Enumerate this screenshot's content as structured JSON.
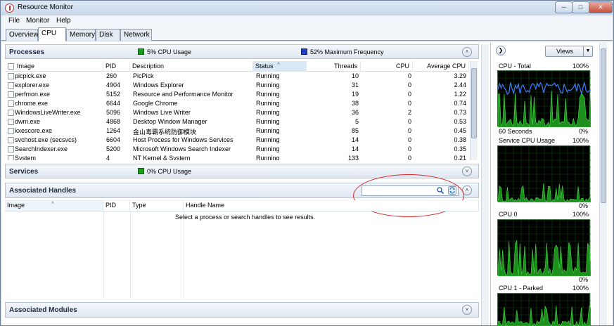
{
  "window": {
    "title": "Resource Monitor",
    "min_glyph": "─",
    "max_glyph": "□",
    "close_glyph": "✕"
  },
  "menu": [
    "File",
    "Monitor",
    "Help"
  ],
  "tabs": [
    "Overview",
    "CPU",
    "Memory",
    "Disk",
    "Network"
  ],
  "active_tab": "CPU",
  "processes": {
    "title": "Processes",
    "legend_cpu": "5% CPU Usage",
    "legend_freq": "52% Maximum Frequency",
    "legend_cpu_color": "#1b9c1b",
    "legend_freq_color": "#1f3fbf",
    "columns": [
      "Image",
      "PID",
      "Description",
      "Status",
      "Threads",
      "CPU",
      "Average CPU"
    ],
    "rows": [
      [
        "picpick.exe",
        "260",
        "PicPick",
        "Running",
        "10",
        "0",
        "3.29"
      ],
      [
        "explorer.exe",
        "4904",
        "Windows Explorer",
        "Running",
        "31",
        "0",
        "2.44"
      ],
      [
        "perfmon.exe",
        "5152",
        "Resource and Performance Monitor",
        "Running",
        "19",
        "0",
        "1.22"
      ],
      [
        "chrome.exe",
        "6644",
        "Google Chrome",
        "Running",
        "38",
        "0",
        "0.74"
      ],
      [
        "WindowsLiveWriter.exe",
        "5096",
        "Windows Live Writer",
        "Running",
        "36",
        "2",
        "0.73"
      ],
      [
        "dwm.exe",
        "4868",
        "Desktop Window Manager",
        "Running",
        "5",
        "0",
        "0.53"
      ],
      [
        "kxescore.exe",
        "1264",
        "金山毒霸系统防御模块",
        "Running",
        "85",
        "0",
        "0.45"
      ],
      [
        "svchost.exe (secsvcs)",
        "6604",
        "Host Process for Windows Services",
        "Running",
        "14",
        "0",
        "0.38"
      ],
      [
        "SearchIndexer.exe",
        "5200",
        "Microsoft Windows Search Indexer",
        "Running",
        "14",
        "0",
        "0.35"
      ],
      [
        "System",
        "4",
        "NT Kernel & System",
        "Running",
        "133",
        "0",
        "0.21"
      ]
    ]
  },
  "services": {
    "title": "Services",
    "legend_cpu": "0% CPU Usage",
    "legend_cpu_color": "#1b9c1b"
  },
  "handles": {
    "title": "Associated Handles",
    "columns": [
      "Image",
      "PID",
      "Type",
      "Handle Name"
    ],
    "empty_message": "Select a process or search handles to see results.",
    "search_placeholder": ""
  },
  "modules": {
    "title": "Associated Modules"
  },
  "right_pane": {
    "nav_glyph": "❯",
    "views_label": "Views",
    "views_arrow": "▼",
    "graphs": [
      {
        "title": "CPU - Total",
        "max": "100%",
        "bottom_left": "60 Seconds",
        "bottom_right": "0%"
      },
      {
        "title": "Service CPU Usage",
        "max": "100%",
        "bottom_left": "",
        "bottom_right": "0%"
      },
      {
        "title": "CPU 0",
        "max": "100%",
        "bottom_left": "",
        "bottom_right": "0%"
      },
      {
        "title": "CPU 1 - Parked",
        "max": "100%",
        "bottom_left": "",
        "bottom_right": ""
      }
    ]
  },
  "collapse_up": "˄",
  "collapse_down": "˅",
  "sort_arrow": "˄"
}
